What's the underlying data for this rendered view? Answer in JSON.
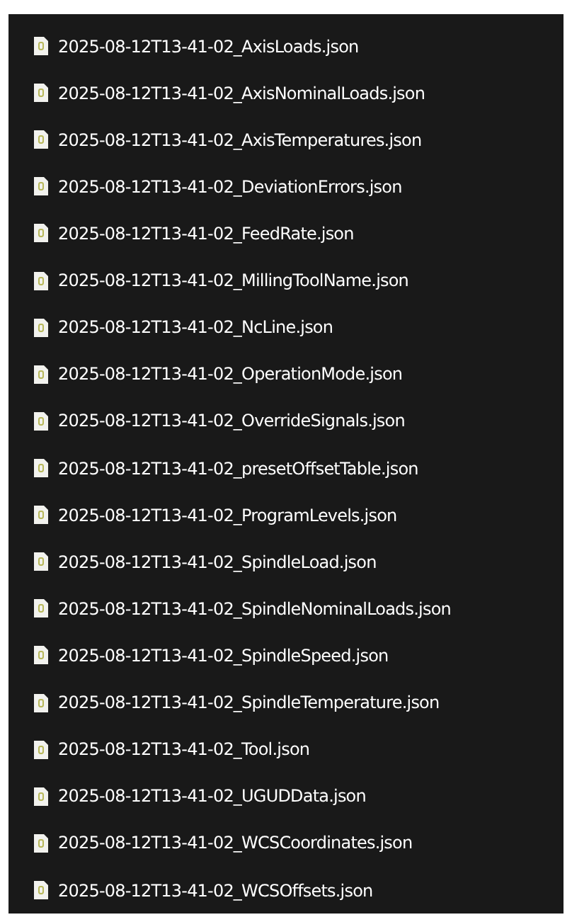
{
  "files": [
    {
      "name": "2025-08-12T13-41-02_AxisLoads.json"
    },
    {
      "name": "2025-08-12T13-41-02_AxisNominalLoads.json"
    },
    {
      "name": "2025-08-12T13-41-02_AxisTemperatures.json"
    },
    {
      "name": "2025-08-12T13-41-02_DeviationErrors.json"
    },
    {
      "name": "2025-08-12T13-41-02_FeedRate.json"
    },
    {
      "name": "2025-08-12T13-41-02_MillingToolName.json"
    },
    {
      "name": "2025-08-12T13-41-02_NcLine.json"
    },
    {
      "name": "2025-08-12T13-41-02_OperationMode.json"
    },
    {
      "name": "2025-08-12T13-41-02_OverrideSignals.json"
    },
    {
      "name": "2025-08-12T13-41-02_presetOffsetTable.json"
    },
    {
      "name": "2025-08-12T13-41-02_ProgramLevels.json"
    },
    {
      "name": "2025-08-12T13-41-02_SpindleLoad.json"
    },
    {
      "name": "2025-08-12T13-41-02_SpindleNominalLoads.json"
    },
    {
      "name": "2025-08-12T13-41-02_SpindleSpeed.json"
    },
    {
      "name": "2025-08-12T13-41-02_SpindleTemperature.json"
    },
    {
      "name": "2025-08-12T13-41-02_Tool.json"
    },
    {
      "name": "2025-08-12T13-41-02_UGUDData.json"
    },
    {
      "name": "2025-08-12T13-41-02_WCSCoordinates.json"
    },
    {
      "name": "2025-08-12T13-41-02_WCSOffsets.json"
    }
  ]
}
